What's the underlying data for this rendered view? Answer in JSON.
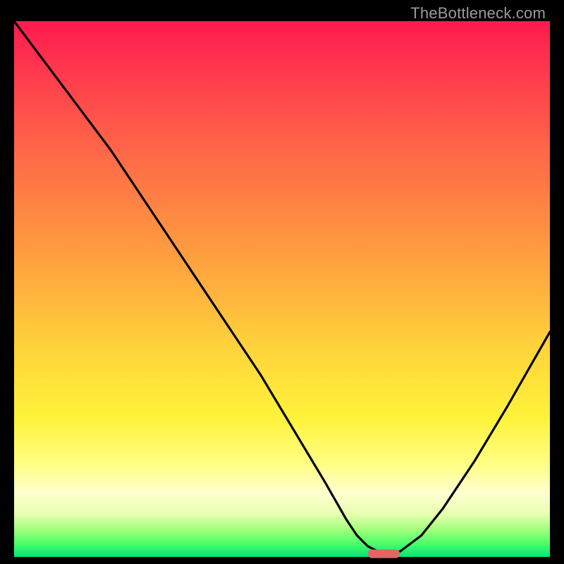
{
  "watermark": "TheBottleneck.com",
  "colors": {
    "gradient_top": "#ff1a4f",
    "gradient_mid": "#ffd63a",
    "gradient_bottom": "#00e676",
    "curve": "#000000",
    "marker": "#e06666",
    "background": "#000000"
  },
  "chart_data": {
    "type": "line",
    "title": "",
    "xlabel": "",
    "ylabel": "",
    "xlim": [
      0,
      100
    ],
    "ylim": [
      0,
      100
    ],
    "note": "Axes are unlabeled in the source image; values are normalized estimates read from pixel positions (x: left→right, y: bottom→top).",
    "series": [
      {
        "name": "curve",
        "x": [
          0,
          6,
          12,
          18,
          22,
          28,
          34,
          40,
          46,
          52,
          58,
          62,
          64,
          66,
          68,
          70,
          72,
          76,
          80,
          86,
          92,
          100
        ],
        "y": [
          100,
          92,
          84,
          76,
          70,
          61,
          52,
          43,
          34,
          24,
          14,
          7,
          4,
          2,
          1,
          1,
          1,
          4,
          9,
          18,
          28,
          42
        ]
      }
    ],
    "marker": {
      "name": "optimum",
      "x": 69,
      "y": 0.6,
      "width_x": 6,
      "height_y": 1.6
    }
  }
}
